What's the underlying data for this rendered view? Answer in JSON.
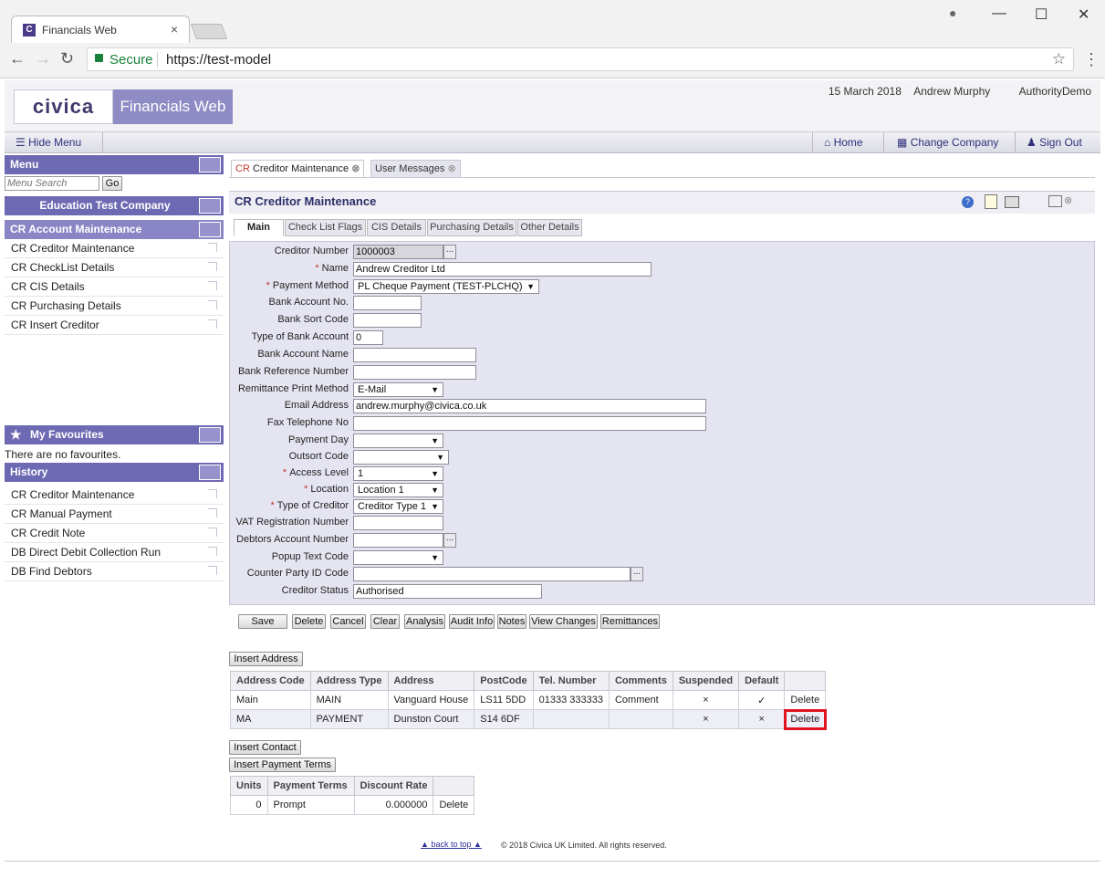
{
  "browser": {
    "tab_title": "Financials Web",
    "tab_close": "×",
    "secure_label": "Secure",
    "url": "https://test-model",
    "star": "☆",
    "min": "—",
    "max": "☐",
    "close": "✕",
    "back": "←",
    "forward": "→",
    "reload": "↻",
    "menu": "⋮",
    "profile": "●"
  },
  "header": {
    "logo": "civica",
    "app_name": "Financials Web",
    "date": "15 March 2018",
    "user": "Andrew Murphy",
    "authority": "AuthorityDemo"
  },
  "navbar": {
    "hide_menu": "Hide Menu",
    "home": "Home",
    "change_company": "Change Company",
    "sign_out": "Sign Out"
  },
  "sidebar": {
    "menu_title": "Menu",
    "search_placeholder": "Menu Search",
    "go_label": "Go",
    "company": "Education Test Company",
    "module_title": "CR Account Maintenance",
    "items": [
      {
        "label": "CR Creditor Maintenance"
      },
      {
        "label": "CR CheckList Details"
      },
      {
        "label": "CR CIS Details"
      },
      {
        "label": "CR Purchasing Details"
      },
      {
        "label": "CR Insert Creditor"
      }
    ],
    "favourites_title": "My Favourites",
    "favourites_empty": "There are no favourites.",
    "history_title": "History",
    "history": [
      {
        "label": "CR Creditor Maintenance"
      },
      {
        "label": "CR Manual Payment"
      },
      {
        "label": "CR Credit Note"
      },
      {
        "label": "DB Direct Debit Collection Run"
      },
      {
        "label": "DB Find Debtors"
      }
    ]
  },
  "content_tabs": [
    {
      "prefix": "CR",
      "label": "Creditor Maintenance",
      "close": "⊗"
    },
    {
      "label": "User Messages",
      "close": "⊗"
    }
  ],
  "panel_title": "CR Creditor Maintenance",
  "sub_tabs": [
    "Main",
    "Check List Flags",
    "CIS Details",
    "Purchasing Details",
    "Other Details"
  ],
  "form": {
    "creditor_number": {
      "label": "Creditor Number",
      "value": "1000003"
    },
    "name": {
      "label": "Name",
      "value": "Andrew Creditor Ltd"
    },
    "payment_method": {
      "label": "Payment Method",
      "value": "PL Cheque Payment (TEST-PLCHQ)"
    },
    "bank_account_no": {
      "label": "Bank Account No.",
      "value": ""
    },
    "bank_sort_code": {
      "label": "Bank Sort Code",
      "value": ""
    },
    "type_of_bank_account": {
      "label": "Type of Bank Account",
      "value": "0"
    },
    "bank_account_name": {
      "label": "Bank Account Name",
      "value": ""
    },
    "bank_reference_number": {
      "label": "Bank Reference Number",
      "value": ""
    },
    "remittance_print_method": {
      "label": "Remittance Print Method",
      "value": "E-Mail"
    },
    "email_address": {
      "label": "Email Address",
      "value": "andrew.murphy@civica.co.uk"
    },
    "fax_telephone_no": {
      "label": "Fax Telephone No",
      "value": ""
    },
    "payment_day": {
      "label": "Payment Day",
      "value": ""
    },
    "outsort_code": {
      "label": "Outsort Code",
      "value": ""
    },
    "access_level": {
      "label": "Access Level",
      "value": "1"
    },
    "location": {
      "label": "Location",
      "value": "Location 1"
    },
    "type_of_creditor": {
      "label": "Type of Creditor",
      "value": "Creditor Type 1"
    },
    "vat_registration_number": {
      "label": "VAT Registration Number",
      "value": ""
    },
    "debtors_account_number": {
      "label": "Debtors Account Number",
      "value": ""
    },
    "popup_text_code": {
      "label": "Popup Text Code",
      "value": ""
    },
    "counter_party_id_code": {
      "label": "Counter Party ID Code",
      "value": ""
    },
    "creditor_status": {
      "label": "Creditor Status",
      "value": "Authorised"
    },
    "required_mark": "*",
    "ellipsis": "..."
  },
  "actions": {
    "save": "Save",
    "delete": "Delete",
    "cancel": "Cancel",
    "clear": "Clear",
    "analysis": "Analysis",
    "audit_info": "Audit Info",
    "notes": "Notes",
    "view_changes": "View Changes",
    "remittances": "Remittances"
  },
  "address": {
    "insert_label": "Insert Address",
    "headers": [
      "Address Code",
      "Address Type",
      "Address",
      "PostCode",
      "Tel. Number",
      "Comments",
      "Suspended",
      "Default",
      ""
    ],
    "rows": [
      {
        "code": "Main",
        "type": "MAIN",
        "address": "Vanguard House",
        "postcode": "LS11 5DD",
        "tel": "01333 333333",
        "comments": "Comment",
        "suspended": "×",
        "default": "✓",
        "action": "Delete"
      },
      {
        "code": "MA",
        "type": "PAYMENT",
        "address": "Dunston Court",
        "postcode": "S14 6DF",
        "tel": "",
        "comments": "",
        "suspended": "×",
        "default": "×",
        "action": "Delete"
      }
    ]
  },
  "contact": {
    "insert_label": "Insert Contact"
  },
  "payment_terms": {
    "insert_label": "Insert Payment Terms",
    "headers": [
      "Units",
      "Payment Terms",
      "Discount Rate",
      ""
    ],
    "rows": [
      {
        "units": "0",
        "terms": "Prompt",
        "rate": "0.000000",
        "action": "Delete"
      }
    ]
  },
  "footer": {
    "back_to_top": "back to top",
    "copyright": "© 2018 Civica UK Limited. All rights reserved."
  },
  "colors": {
    "accent": "#6e69b3",
    "highlight": "#e0141e"
  }
}
